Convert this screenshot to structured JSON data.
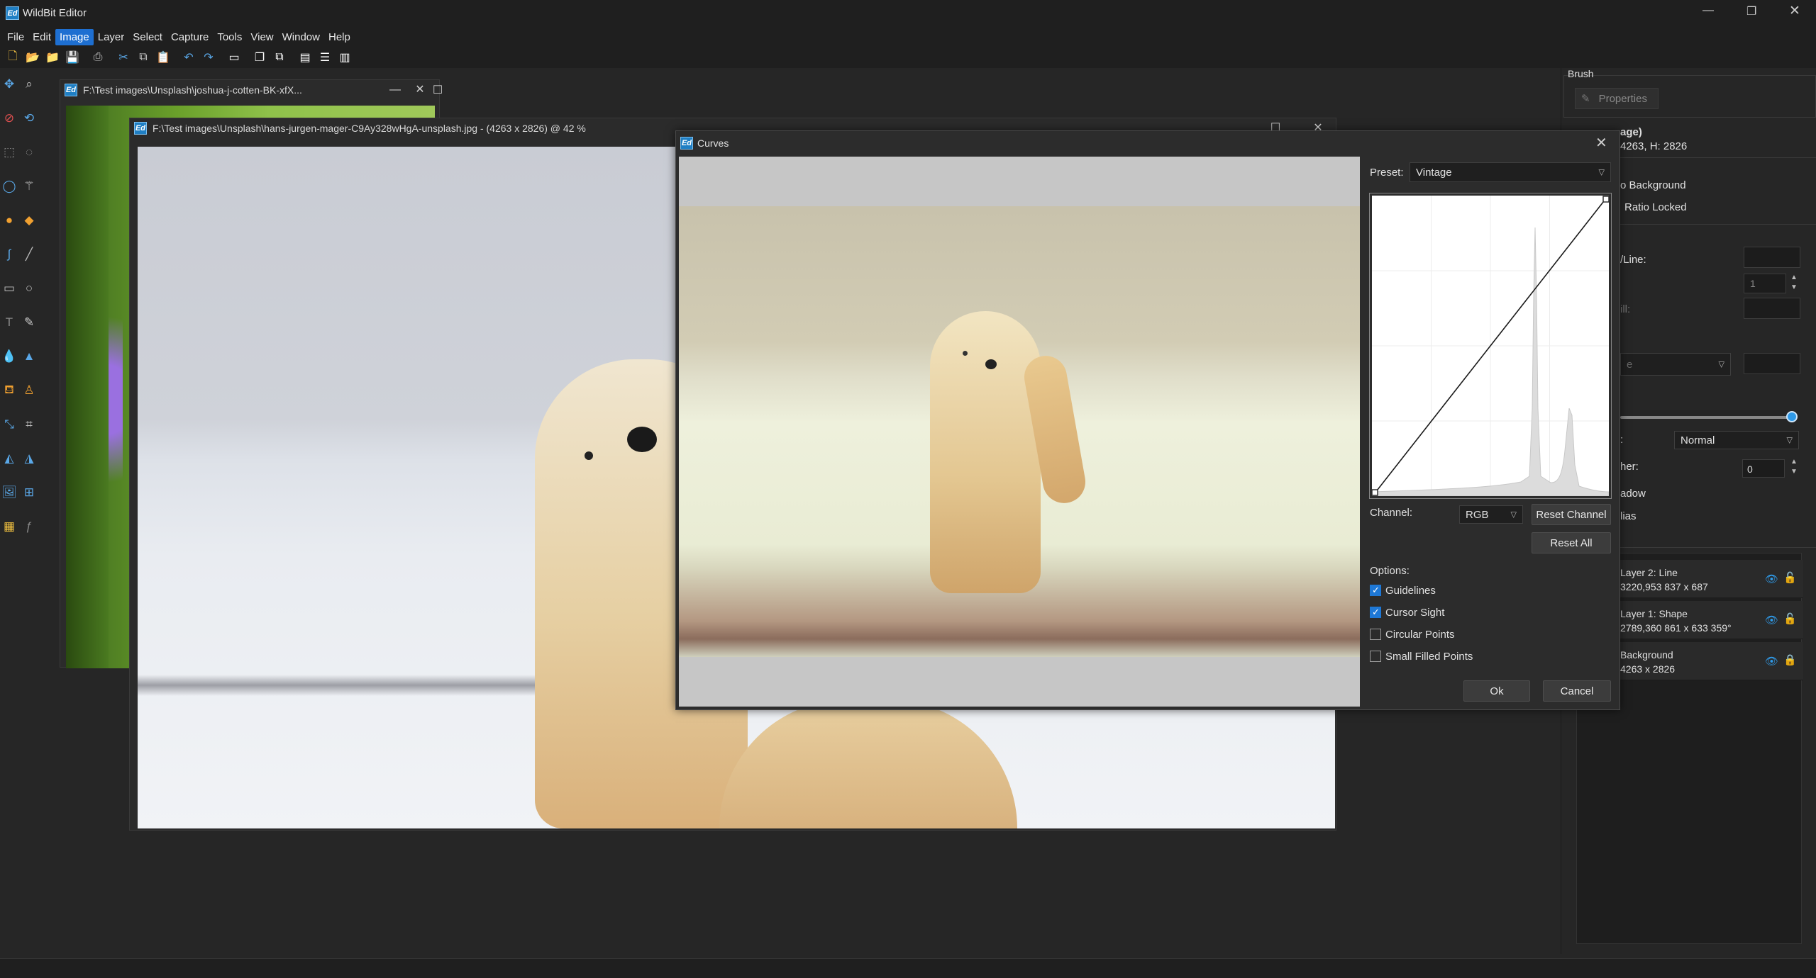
{
  "app": {
    "title": "WildBit Editor",
    "icon": "Ed"
  },
  "menu": [
    "File",
    "Edit",
    "Image",
    "Layer",
    "Select",
    "Capture",
    "Tools",
    "View",
    "Window",
    "Help"
  ],
  "menu_active": "Image",
  "doc1": {
    "title": "F:\\Test images\\Unsplash\\joshua-j-cotten-BK-xfX..."
  },
  "doc2": {
    "title": "F:\\Test images\\Unsplash\\hans-jurgen-mager-C9Ay328wHgA-unsplash.jpg - (4263 x 2826) @ 42  %"
  },
  "curves": {
    "title": "Curves",
    "preset_label": "Preset:",
    "preset_value": "Vintage",
    "channel_label": "Channel:",
    "channel_value": "RGB",
    "reset_channel": "Reset Channel",
    "reset_all": "Reset All",
    "options_label": "Options:",
    "options": [
      {
        "label": "Guidelines",
        "checked": true
      },
      {
        "label": "Cursor Sight",
        "checked": true
      },
      {
        "label": "Circular Points",
        "checked": false
      },
      {
        "label": "Small Filled Points",
        "checked": false
      }
    ],
    "ok": "Ok",
    "cancel": "Cancel"
  },
  "right_panel": {
    "brush_label": "Brush",
    "properties_button": "Properties",
    "image_title": "age)",
    "image_size": "4263, H: 2826",
    "background_label": "o Background",
    "ratio_locked": "Ratio Locked",
    "line_label": "/Line:",
    "stroke_value": "1",
    "fill_label": "ill:",
    "style_value": "e",
    "blend_label": ":",
    "blend_value": "Normal",
    "feather_label": "her:",
    "feather_value": "0",
    "shadow_label": "adow",
    "antialias_label": "lias",
    "slider_value": 1.0,
    "layers": [
      {
        "name": "Layer 2: Line",
        "info": "3220,953  837 x 687",
        "locked": false
      },
      {
        "name": "Layer 1: Shape",
        "info": "2789,360  861 x 633  359°",
        "locked": false
      },
      {
        "name": "Background",
        "info": "4263 x 2826",
        "locked": true
      }
    ]
  },
  "colors": {
    "accent": "#1e78d6",
    "eye": "#2f9ae8"
  }
}
